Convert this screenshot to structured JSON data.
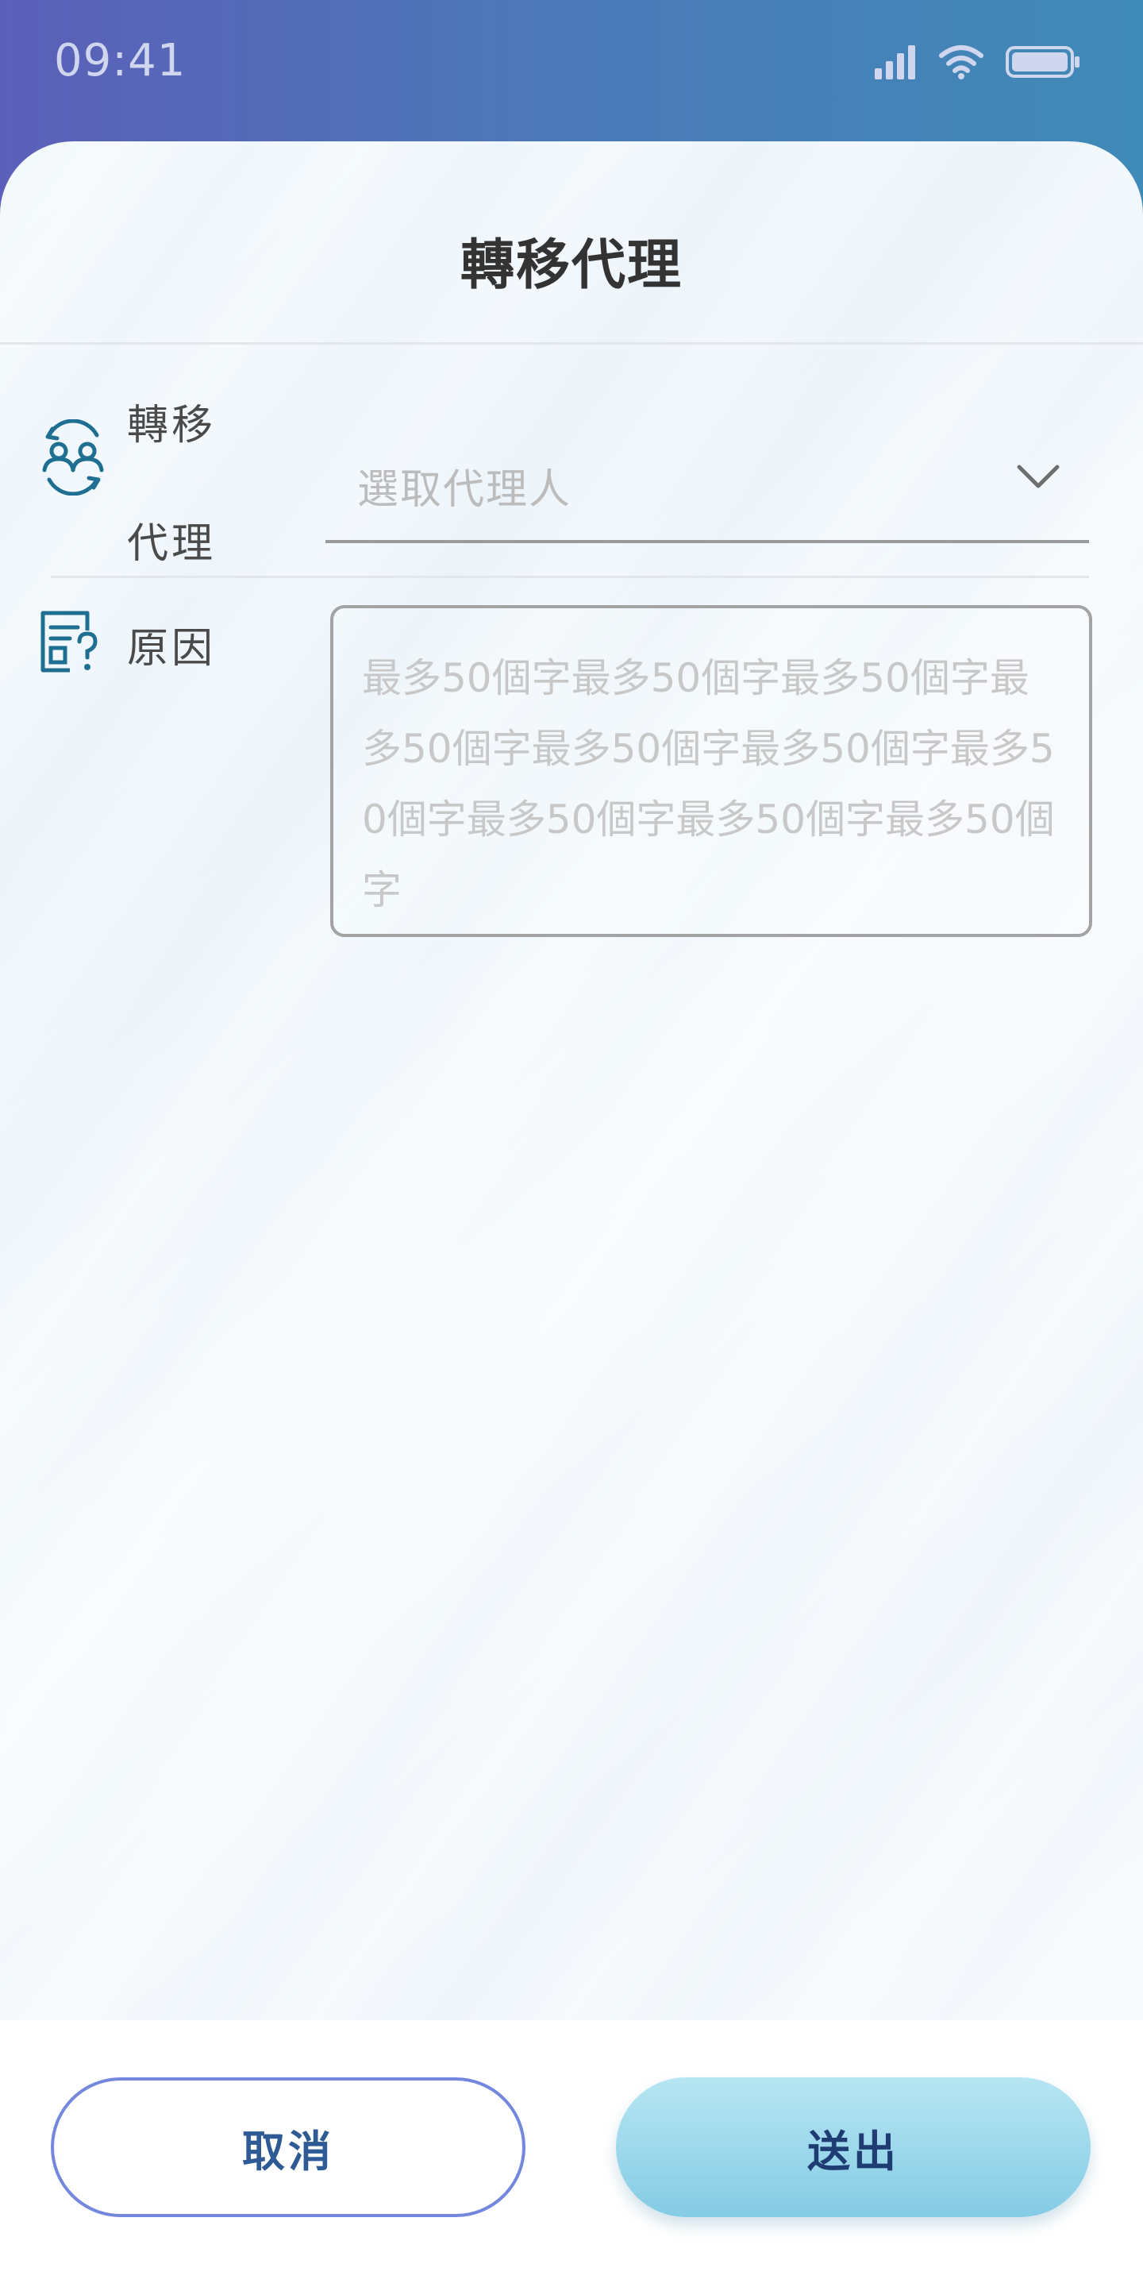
{
  "status_bar": {
    "time": "09:41",
    "icons": [
      "signal-icon",
      "wifi-icon",
      "battery-icon"
    ]
  },
  "sheet": {
    "title": "轉移代理"
  },
  "agent_field": {
    "icon": "users-transfer-icon",
    "label_line1": "轉移",
    "label_line2": "代理",
    "placeholder": "選取代理人",
    "dropdown_icon": "chevron-down-icon"
  },
  "reason_field": {
    "icon": "document-question-icon",
    "label": "原因",
    "placeholder": "最多50個字最多50個字最多50個字最多50個字最多50個字最多50個字最多50個字最多50個字最多50個字最多50個字"
  },
  "footer": {
    "cancel_label": "取消",
    "submit_label": "送出"
  },
  "colors": {
    "accent_icon": "#1f6f93",
    "cancel_border": "#7388dd",
    "submit_bg": "#9fd8ec"
  }
}
